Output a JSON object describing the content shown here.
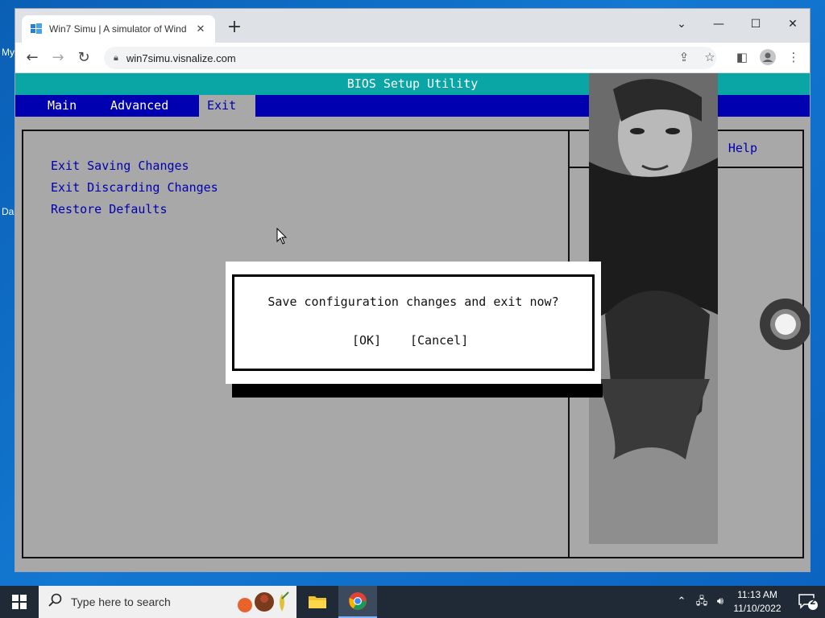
{
  "desktop": {
    "icon_label_1": "My",
    "icon_label_2": "Da"
  },
  "browser": {
    "tab_title": "Win7 Simu | A simulator of Wind",
    "tab_close": "✕",
    "new_tab": "+",
    "url": "win7simu.visnalize.com",
    "win_minimize": "—",
    "win_maximize": "☐",
    "win_close": "✕",
    "win_dropdown": "⌄"
  },
  "bios": {
    "title": "BIOS Setup Utility",
    "menu": [
      {
        "label": "Main",
        "active": false
      },
      {
        "label": "Advanced",
        "active": false
      },
      {
        "label": "Exit",
        "active": true
      }
    ],
    "items": [
      "Exit Saving Changes",
      "Exit Discarding Changes",
      "Restore Defaults"
    ],
    "help_title": "Help"
  },
  "dialog": {
    "message": "Save configuration changes and exit now?",
    "ok_label": "[OK]",
    "cancel_label": "[Cancel]"
  },
  "taskbar": {
    "search_placeholder": "Type here to search",
    "clock_time": "11:13 AM",
    "clock_date": "11/10/2022",
    "notification_count": "2"
  },
  "colors": {
    "bios_menubar": "#0000b0",
    "bios_title": "#0aa6a6",
    "bios_bg": "#a8a8a8",
    "desktop": "#0b63c0"
  }
}
